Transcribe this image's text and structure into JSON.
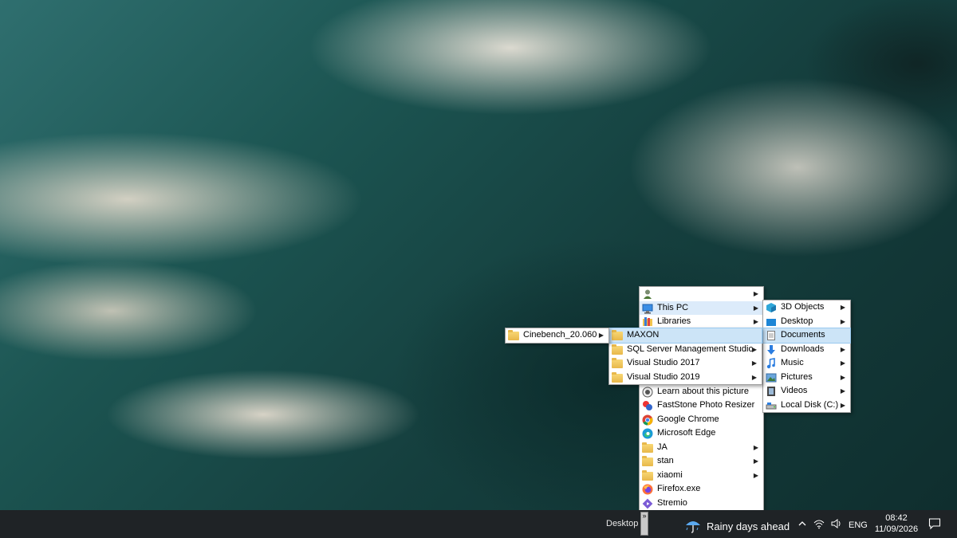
{
  "main_menu": {
    "items": [
      {
        "label": "",
        "icon": "user-icon",
        "submenu": true
      },
      {
        "label": "This PC",
        "icon": "computer-icon",
        "submenu": true,
        "highlighted": true
      },
      {
        "label": "Libraries",
        "icon": "libraries-icon",
        "submenu": true
      },
      {
        "label": "",
        "icon": "",
        "submenu": false
      },
      {
        "label": "",
        "icon": "",
        "submenu": false
      },
      {
        "label": "",
        "icon": "",
        "submenu": false
      },
      {
        "label": "",
        "icon": "",
        "submenu": false
      },
      {
        "label": "Learn about this picture",
        "icon": "camera-icon",
        "submenu": false
      },
      {
        "label": "FastStone Photo Resizer",
        "icon": "faststone-icon",
        "submenu": false
      },
      {
        "label": "Google Chrome",
        "icon": "chrome-icon",
        "submenu": false
      },
      {
        "label": "Microsoft Edge",
        "icon": "edge-icon",
        "submenu": false
      },
      {
        "label": "JA",
        "icon": "folder-icon",
        "submenu": true
      },
      {
        "label": "stan",
        "icon": "folder-icon",
        "submenu": true
      },
      {
        "label": "xiaomi",
        "icon": "folder-icon",
        "submenu": true
      },
      {
        "label": "Firefox.exe",
        "icon": "firefox-icon",
        "submenu": false
      },
      {
        "label": "Stremio",
        "icon": "stremio-icon",
        "submenu": false
      }
    ]
  },
  "thispc_menu": {
    "items": [
      {
        "label": "3D Objects",
        "icon": "3d-objects-icon"
      },
      {
        "label": "Desktop",
        "icon": "desktop-folder-icon"
      },
      {
        "label": "Documents",
        "icon": "documents-icon",
        "highlighted": true
      },
      {
        "label": "Downloads",
        "icon": "downloads-icon"
      },
      {
        "label": "Music",
        "icon": "music-icon"
      },
      {
        "label": "Pictures",
        "icon": "pictures-icon"
      },
      {
        "label": "Videos",
        "icon": "videos-icon"
      },
      {
        "label": "Local Disk (C:)",
        "icon": "disk-icon"
      }
    ]
  },
  "documents_menu": {
    "items": [
      {
        "label": "MAXON",
        "highlighted": true
      },
      {
        "label": "SQL Server Management Studio"
      },
      {
        "label": "Visual Studio 2017"
      },
      {
        "label": "Visual Studio 2019"
      }
    ]
  },
  "maxon_menu": {
    "items": [
      {
        "label": "Cinebench_20.060"
      }
    ]
  },
  "taskbar": {
    "desktop_label": "Desktop",
    "desktop_button": "»",
    "weather_text": "Rainy days ahead",
    "language": "ENG",
    "time": "08:42",
    "date": "11/09/2026"
  }
}
